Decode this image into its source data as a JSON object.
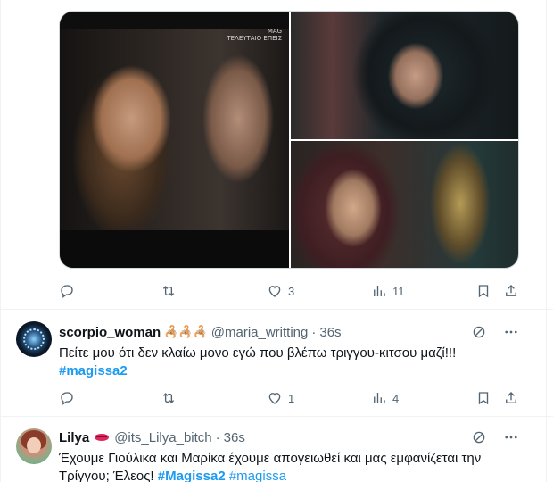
{
  "post1": {
    "media": {
      "watermark_line1": "MAG",
      "watermark_line2": "ΤΕΛΕΥΤΑΙΟ ΕΠΕΙΣ"
    },
    "actions": {
      "replies": "",
      "reposts": "",
      "likes": "3",
      "views": "11"
    }
  },
  "post2": {
    "name": "scorpio_woman",
    "name_emoji": "🦂🦂🦂",
    "handle": "@maria_writting",
    "dot": "·",
    "time": "36s",
    "text": "Πείτε μου ότι δεν κλαίω μονο εγώ που βλέπω τριγγου-κιτσου μαζί!!!",
    "hashtag": "#magissa2",
    "actions": {
      "replies": "",
      "reposts": "",
      "likes": "1",
      "views": "4"
    }
  },
  "post3": {
    "name": "Lilya",
    "handle": "@its_Lilya_bitch",
    "dot": "·",
    "time": "36s",
    "text_line1": "Έχουμε Γιούλικα και Μαρίκα έχουμε απογειωθεί και μας εμφανίζεται την",
    "text_line2_prefix": "Τρίγγου; Έλεος!",
    "hashtag1": "#Magissa2",
    "hashtag2": "#magissa"
  },
  "icons": {
    "reply": "reply-icon",
    "repost": "repost-icon",
    "like": "heart-icon",
    "views": "analytics-icon",
    "bookmark": "bookmark-icon",
    "share": "share-icon",
    "grok": "grok-icon",
    "more": "more-icon"
  },
  "colors": {
    "accent": "#1d9bf0",
    "muted": "#536471",
    "text": "#0f1419",
    "divider": "#eff3f4"
  }
}
